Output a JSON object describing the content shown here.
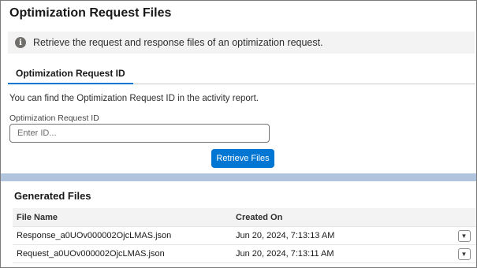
{
  "page": {
    "title": "Optimization Request Files",
    "banner_text": "Retrieve the request and response files of an optimization request.",
    "info_icon": "info-icon"
  },
  "tabs": [
    {
      "label": "Optimization Request ID",
      "active": true
    }
  ],
  "form": {
    "hint": "You can find the Optimization Request ID in the activity report.",
    "field_label": "Optimization Request ID",
    "placeholder": "Enter ID...",
    "value": "",
    "button_label": "Retrieve Files",
    "button_color": "#0176d3"
  },
  "generated": {
    "title": "Generated Files",
    "columns": [
      "File Name",
      "Created On"
    ],
    "rows": [
      {
        "file_name": "Response_a0UOv000002OjcLMAS.json",
        "created_on": "Jun 20, 2024, 7:13:13 AM",
        "action_icon": "chevron-down-icon"
      },
      {
        "file_name": "Request_a0UOv000002OjcLMAS.json",
        "created_on": "Jun 20, 2024, 7:13:11 AM",
        "action_icon": "chevron-down-icon"
      }
    ]
  }
}
